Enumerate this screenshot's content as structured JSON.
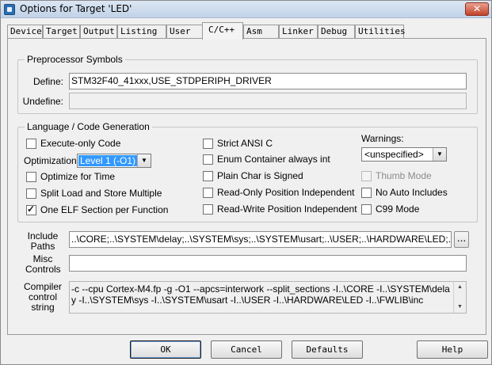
{
  "window": {
    "title": "Options for Target 'LED'",
    "close_glyph": "✕"
  },
  "tabs": [
    "Device",
    "Target",
    "Output",
    "Listing",
    "User",
    "C/C++",
    "Asm",
    "Linker",
    "Debug",
    "Utilities"
  ],
  "active_tab": "C/C++",
  "preprocessor": {
    "group_title": "Preprocessor Symbols",
    "define_label": "Define:",
    "define_value": "STM32F40_41xxx,USE_STDPERIPH_DRIVER",
    "undefine_label": "Undefine:",
    "undefine_value": ""
  },
  "language": {
    "group_title": "Language / Code Generation",
    "execute_only": {
      "label": "Execute-only Code",
      "checked": false
    },
    "optimization_label": "Optimization:",
    "optimization_value": "Level 1 (-O1)",
    "optimize_time": {
      "label": "Optimize for Time",
      "checked": false
    },
    "split_load": {
      "label": "Split Load and Store Multiple",
      "checked": false
    },
    "one_elf": {
      "label": "One ELF Section per Function",
      "checked": true
    },
    "strict_ansi": {
      "label": "Strict ANSI C",
      "checked": false
    },
    "enum_container": {
      "label": "Enum Container always int",
      "checked": false
    },
    "plain_char": {
      "label": "Plain Char is Signed",
      "checked": false
    },
    "ro_pos_indep": {
      "label": "Read-Only Position Independent",
      "checked": false
    },
    "rw_pos_indep": {
      "label": "Read-Write Position Independent",
      "checked": false
    },
    "warnings_label": "Warnings:",
    "warnings_value": "<unspecified>",
    "thumb_mode": {
      "label": "Thumb Mode",
      "checked": false,
      "disabled": true
    },
    "no_auto_includes": {
      "label": "No Auto Includes",
      "checked": false
    },
    "c99_mode": {
      "label": "C99 Mode",
      "checked": false
    }
  },
  "include_paths": {
    "label_line1": "Include",
    "label_line2": "Paths",
    "value": "..\\CORE;..\\SYSTEM\\delay;..\\SYSTEM\\sys;..\\SYSTEM\\usart;..\\USER;..\\HARDWARE\\LED;..\\FWL",
    "browse_label": "..."
  },
  "misc_controls": {
    "label_line1": "Misc",
    "label_line2": "Controls",
    "value": ""
  },
  "compiler_control": {
    "label_line1": "Compiler",
    "label_line2": "control",
    "label_line3": "string",
    "value": "-c --cpu Cortex-M4.fp -g -O1 --apcs=interwork --split_sections -I..\\CORE -I..\\SYSTEM\\delay -I..\\SYSTEM\\sys -I..\\SYSTEM\\usart -I..\\USER -I..\\HARDWARE\\LED -I..\\FWLIB\\inc"
  },
  "buttons": {
    "ok": "OK",
    "cancel": "Cancel",
    "defaults": "Defaults",
    "help": "Help"
  },
  "colors": {
    "selection": "#3399ff",
    "dialog_bg": "#f0f0f0"
  }
}
